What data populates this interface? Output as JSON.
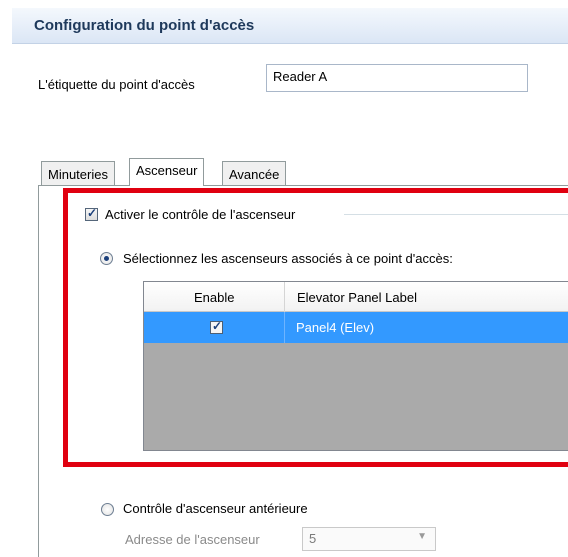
{
  "header": {
    "title": "Configuration du point d'accès"
  },
  "access_point": {
    "label": "L'étiquette du point d'accès",
    "value": "Reader A"
  },
  "tabs": [
    {
      "label": "Minuteries",
      "active": false
    },
    {
      "label": "Ascenseur",
      "active": true
    },
    {
      "label": "Avancée",
      "active": false
    }
  ],
  "elevator": {
    "enable_label": "Activer le contrôle de l'ascenseur",
    "enable_checked": true,
    "select_label": "Sélectionnez les ascenseurs associés à ce point d'accès:",
    "select_selected": true,
    "grid": {
      "columns": [
        "Enable",
        "Elevator Panel Label"
      ],
      "rows": [
        {
          "enabled": true,
          "label": "Panel4 (Elev)"
        }
      ]
    },
    "legacy_label": "Contrôle d'ascenseur antérieure",
    "legacy_selected": false,
    "address_label": "Adresse de l'ascenseur",
    "address_value": "5"
  },
  "colors": {
    "highlight": "#e00010",
    "selection": "#3399ff",
    "title": "#1e395b"
  },
  "icons": {
    "check": "check-mark-icon",
    "dropdown": "chevron-down-icon"
  }
}
